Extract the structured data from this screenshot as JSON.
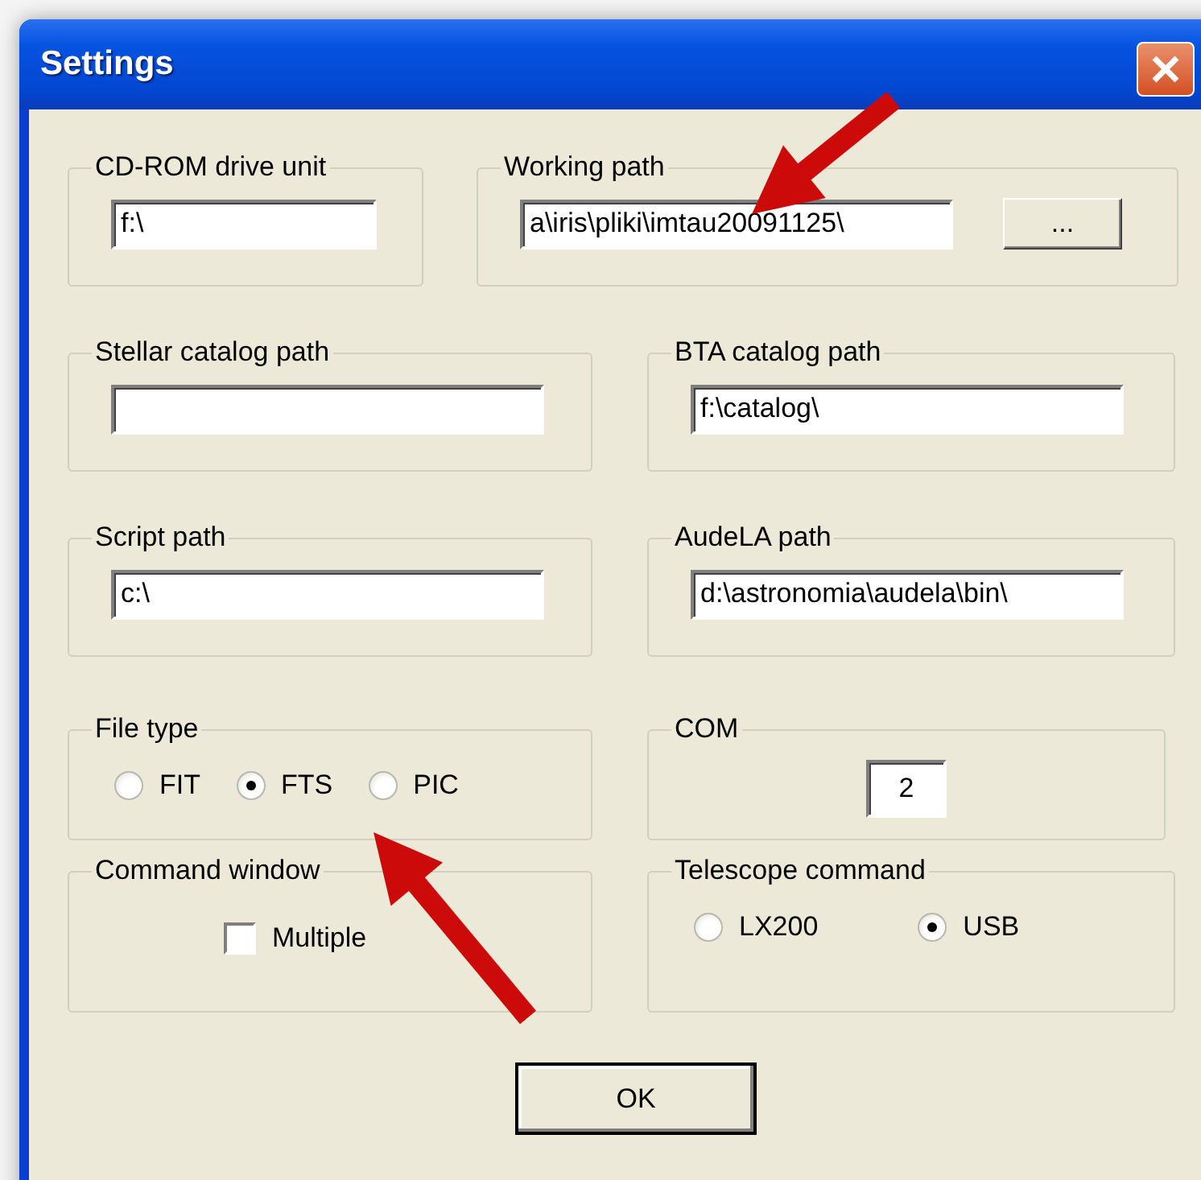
{
  "window": {
    "title": "Settings"
  },
  "rows": [
    [
      {
        "kind": "field",
        "label": "CD-ROM drive unit",
        "value": "f:\\"
      },
      {
        "kind": "field_button",
        "label": "Working path",
        "value": "a\\iris\\pliki\\imtau20091125\\",
        "button": "..."
      }
    ],
    [
      {
        "kind": "field",
        "label": "Stellar catalog path"
      },
      {
        "kind": "field",
        "label": "BTA catalog path",
        "value": "f:\\catalog\\"
      }
    ],
    [
      {
        "kind": "field",
        "label": "Script path",
        "value": "c:\\"
      },
      {
        "kind": "field",
        "label": "AudeLA path",
        "value": "d:\\astronomia\\audela\\bin\\"
      }
    ],
    [
      {
        "kind": "radios",
        "label": "File type",
        "options": [
          {
            "label": "FIT",
            "selected": false
          },
          {
            "label": "FTS",
            "selected": true
          },
          {
            "label": "PIC",
            "selected": false
          }
        ]
      },
      {
        "kind": "small_field",
        "label": "COM",
        "value": "2"
      }
    ],
    [
      {
        "kind": "checkbox",
        "label": "Command window",
        "option": {
          "label": "Multiple",
          "checked": false
        }
      },
      {
        "kind": "radios",
        "label": "Telescope command",
        "options": [
          {
            "label": "LX200",
            "selected": false
          },
          {
            "label": "USB",
            "selected": true
          }
        ]
      }
    ]
  ],
  "buttons": [
    "OK"
  ],
  "annotations": [
    {
      "kind": "arrow"
    },
    {
      "kind": "arrow"
    }
  ]
}
